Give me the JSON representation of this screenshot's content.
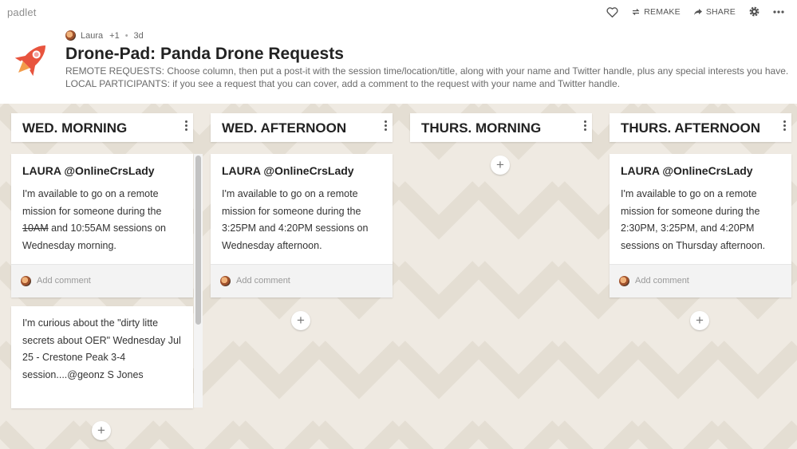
{
  "app": {
    "brand": "padlet"
  },
  "toolbar": {
    "like_icon": "heart-icon",
    "remake_label": "REMAKE",
    "share_label": "SHARE",
    "settings_icon": "gear-icon",
    "more_icon": "more-icon"
  },
  "board": {
    "author": "Laura",
    "contributors": "+1",
    "age": "3d",
    "title": "Drone-Pad: Panda Drone Requests",
    "description": "REMOTE REQUESTS: Choose column, then put a post-it with the session time/location/title, along with your name and Twitter handle, plus any special interests you have. LOCAL PARTICIPANTS: if you see a request that you can cover, add a comment to the request with your name and Twitter handle."
  },
  "columns": [
    {
      "title": "WED. MORNING"
    },
    {
      "title": "WED. AFTERNOON"
    },
    {
      "title": "THURS. MORNING"
    },
    {
      "title": "THURS. AFTERNOON"
    }
  ],
  "posts": {
    "wed_morning_1": {
      "author": "LAURA @OnlineCrsLady",
      "text_a": "I'm available to go on a remote mission for someone during the ",
      "struck": "10AM",
      "text_b": " and 10:55AM sessions on Wednesday morning."
    },
    "wed_morning_2": {
      "text": "I'm curious about the \"dirty litte secrets about OER\" Wednesday Jul 25 - Crestone Peak 3-4 session....@geonz  S Jones"
    },
    "wed_afternoon_1": {
      "author": "LAURA @OnlineCrsLady",
      "text": "I'm available to go on a remote mission for someone during the 3:25PM and 4:20PM sessions on Wednesday afternoon."
    },
    "thurs_afternoon_1": {
      "author": "LAURA @OnlineCrsLady",
      "text": "I'm available to go on a remote mission for someone during the 2:30PM, 3:25PM, and 4:20PM sessions on Thursday afternoon."
    }
  },
  "comment_placeholder": "Add comment",
  "add_post_symbol": "+",
  "colors": {
    "accent_logo": "#e8543e",
    "background": "#efeae2",
    "chevron": "#e4ded3"
  }
}
